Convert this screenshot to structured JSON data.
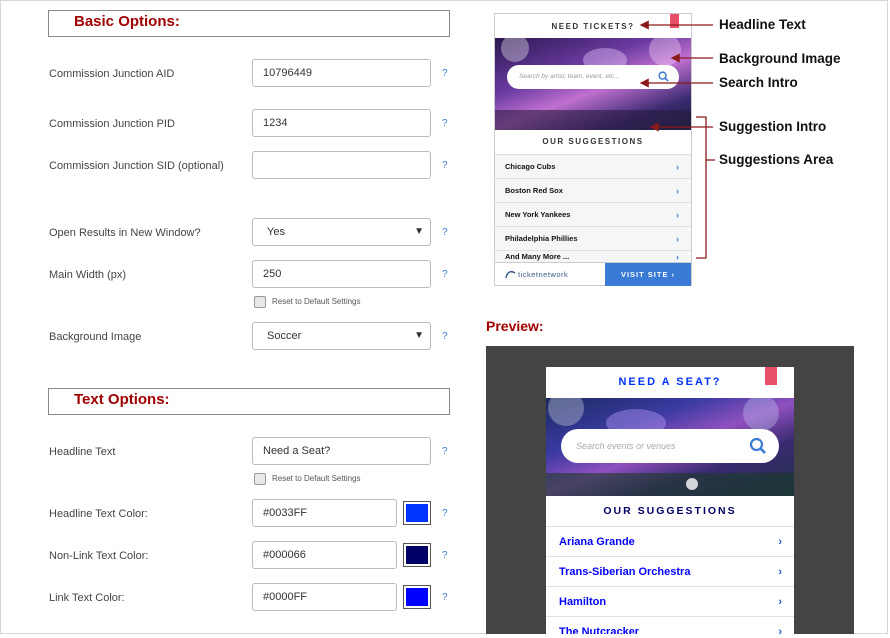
{
  "basic_options": {
    "title": "Basic Options:",
    "fields": [
      {
        "label": "Commission Junction AID",
        "value": "10796449",
        "help": "?"
      },
      {
        "label": "Commission Junction PID",
        "value": "1234",
        "help": "?"
      },
      {
        "label": "Commission Junction SID (optional)",
        "value": "",
        "help": "?"
      },
      {
        "label": "Open Results in New Window?",
        "value": "Yes",
        "help": "?"
      },
      {
        "label": "Main Width (px)",
        "value": "250",
        "help": "?",
        "reset": "Reset to Default Settings"
      },
      {
        "label": "Background Image",
        "value": "Soccer",
        "help": "?"
      }
    ]
  },
  "text_options": {
    "title": "Text Options:",
    "fields": [
      {
        "label": "Headline Text",
        "value": "Need a Seat?",
        "help": "?",
        "reset": "Reset to Default Settings"
      },
      {
        "label": "Headline Text Color:",
        "value": "#0033FF",
        "help": "?",
        "swatch": "#0033FF"
      },
      {
        "label": "Non-Link Text Color:",
        "value": "#000066",
        "help": "?",
        "swatch": "#000066"
      },
      {
        "label": "Link Text Color:",
        "value": "#0000FF",
        "help": "?",
        "swatch": "#0000FF"
      }
    ]
  },
  "sample_widget": {
    "headline": "NEED TICKETS?",
    "search_placeholder": "Search by artist, team, event, etc...",
    "suggestion_intro": "OUR SUGGESTIONS",
    "suggestions": [
      "Chicago Cubs",
      "Boston Red Sox",
      "New York Yankees",
      "Philadelphia Phillies",
      "And Many More ..."
    ],
    "chevron": "›",
    "logo_text": "ticketnetwork",
    "visit_label": "VISIT SITE ›"
  },
  "annotations": {
    "headline": "Headline Text",
    "background": "Background Image",
    "search": "Search Intro",
    "suggestion_intro": "Suggestion Intro",
    "suggestions_area": "Suggestions Area"
  },
  "preview": {
    "label": "Preview:",
    "headline": "NEED A SEAT?",
    "search_placeholder": "Search events or venues",
    "suggestion_intro": "OUR SUGGESTIONS",
    "suggestions": [
      "Ariana Grande",
      "Trans-Siberian Orchestra",
      "Hamilton",
      "The Nutcracker"
    ],
    "chevron": "›"
  },
  "colors": {
    "section_title": "#a00000",
    "accent": "#3a7bd5",
    "bookmark": "#e8506a",
    "preview_bg": "#444444",
    "arrow": "#8b1a1a"
  }
}
